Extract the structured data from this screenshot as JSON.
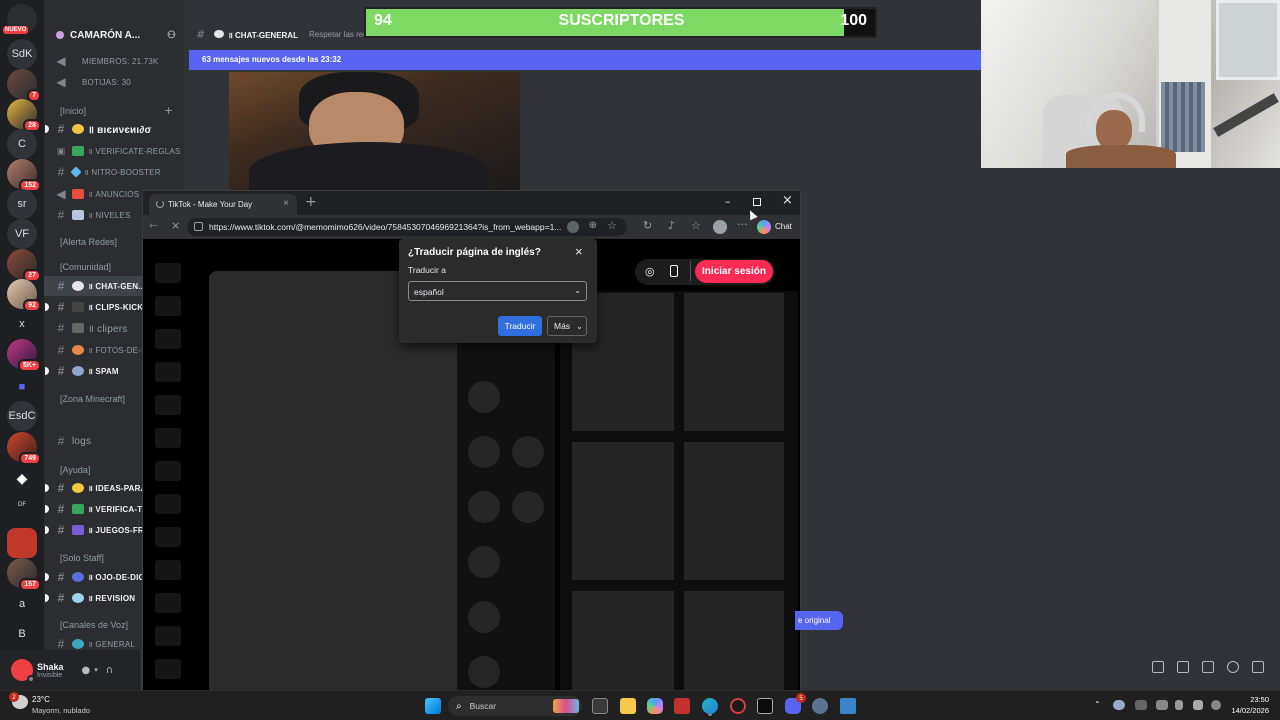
{
  "rail": {
    "items": [
      {
        "label": "",
        "badge": "NUEVO"
      },
      {
        "label": "SdK",
        "badge": ""
      },
      {
        "label": "",
        "badge": "7"
      },
      {
        "label": "",
        "badge": "28"
      },
      {
        "label": "C",
        "badge": ""
      },
      {
        "label": "",
        "badge": "152"
      },
      {
        "label": "sr",
        "badge": ""
      },
      {
        "label": "VF",
        "badge": ""
      },
      {
        "label": "",
        "badge": "27"
      },
      {
        "label": "",
        "badge": "92"
      },
      {
        "label": "x",
        "badge": ""
      },
      {
        "label": "",
        "badge": "5K+"
      },
      {
        "label": "",
        "badge": ""
      },
      {
        "label": "EsdC",
        "badge": ""
      },
      {
        "label": "",
        "badge": "749"
      },
      {
        "label": "",
        "badge": ""
      },
      {
        "label": "DF",
        "badge": ""
      },
      {
        "label": "",
        "badge": ""
      },
      {
        "label": "",
        "badge": "157"
      },
      {
        "label": "a",
        "badge": ""
      },
      {
        "label": "B",
        "badge": ""
      }
    ]
  },
  "server": {
    "name": "CAMARÓN A...",
    "members": "MIEMBROS: 21.73k",
    "botijas": "BOTIJAS: 30"
  },
  "channels": {
    "cat_inicio": "[Inicio]",
    "bienvenido": "॥ вιєиνєиι∂σ",
    "verificate": "॥ verificate-reglas",
    "nitro": "॥ nitro-booster",
    "anuncios": "॥ anuncios",
    "niveles": "॥ niveles",
    "cat_alerta": "[Alerta Redes]",
    "cat_comunidad": "[Comunidad]",
    "chat_general": "॥ chat-gen...",
    "clips_kick": "॥ clips-kick",
    "clipers": "॥ clipers",
    "fotos": "॥ fotos-de-s...",
    "spam": "॥ spam",
    "cat_minecraft": "[Zona Minecraft]",
    "logs": "logs",
    "cat_ayuda": "[Ayuda]",
    "ideas": "॥ ideas-para...",
    "verifica_tu": "॥ verifica-tu...",
    "juegos": "॥ juegos-fre...",
    "cat_staff": "[Solo Staff]",
    "ojo": "॥ ojo-de-dio...",
    "revision": "॥ revision",
    "cat_voz": "[Canales de Voz]",
    "general_voz": "॥ general"
  },
  "user": {
    "name": "Shaka",
    "status": "Invisible"
  },
  "topbar": {
    "channel": "॥ chat-general",
    "topic": "Respetar las reglas"
  },
  "banner": {
    "text": "63 mensajes nuevos desde las 23:32"
  },
  "subs": {
    "current": "94",
    "label": "SUSCRIPTORES",
    "goal": "100",
    "progress": 0.94,
    "fill_color": "#7ed864"
  },
  "browser": {
    "tab_title": "TikTok - Make Your Day",
    "url": "https://www.tiktok.com/@memomimo626/video/7584530704696921364?is_from_webapp=1...",
    "chat_label": "Chat",
    "login_button": "Iniciar sesión",
    "login_color": "#fe2c55"
  },
  "translate": {
    "title": "¿Traducir página de inglés?",
    "to_label": "Traducir a",
    "language": "español",
    "translate_button": "Traducir",
    "more_button": "Más"
  },
  "discord_right": {
    "original_chip": "e original"
  },
  "taskbar": {
    "weather_temp": "23°C",
    "weather_desc": "Mayorm. nublado",
    "weather_badge": "2",
    "search_placeholder": "Buscar",
    "time": "23:50",
    "date": "14/02/2026",
    "discord_badge": "5"
  }
}
